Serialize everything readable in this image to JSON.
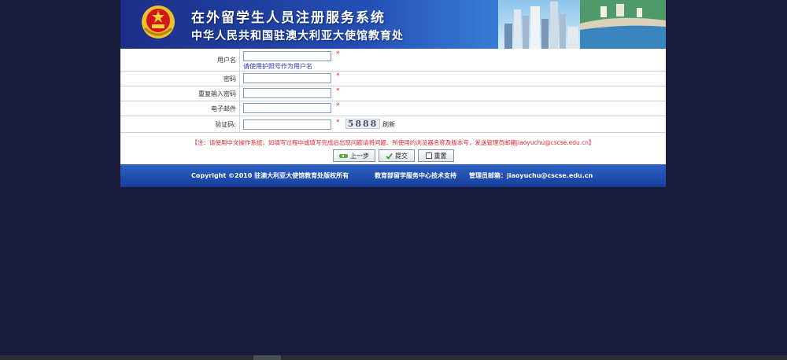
{
  "banner": {
    "title": "在外留学生人员注册服务系统",
    "subtitle": "中华人民共和国驻澳大利亚大使馆教育处"
  },
  "form": {
    "username": {
      "label": "用户名",
      "value": "",
      "required": "*",
      "hint": "请使用护照号作为用户名"
    },
    "password": {
      "label": "密码",
      "value": "",
      "required": "*"
    },
    "confirm_password": {
      "label": "重复输入密码",
      "value": "",
      "required": "*"
    },
    "email": {
      "label": "电子邮件",
      "value": "",
      "required": "*"
    },
    "captcha": {
      "label": "验证码:",
      "value": "",
      "required": "*",
      "code": "5888",
      "refresh_label": "刷新"
    }
  },
  "note": "【注：请使用中文操作系统，如填写过程中或填写完成后出现问题请将问题、所使用的浏览器名称及版本号，发送管理员邮箱jiaoyuchu@cscse.edu.cn】",
  "buttons": {
    "prev": "上一步",
    "submit": "提交",
    "reset": "重置"
  },
  "footer": {
    "copyright": "Copyright ©2010 驻澳大利亚大使馆教育处版权所有",
    "support": "教育部留学服务中心技术支持",
    "admin": "管理员邮箱：jiaoyuchu@cscse.edu.cn"
  },
  "colors": {
    "page_background": "#1a1b3b",
    "banner_blue": "#244fb5",
    "footer_blue": "#1e4fb0",
    "required_red": "#e3262d",
    "hint_blue": "#2a35b3"
  },
  "icons": {
    "emblem": "national-emblem-icon",
    "prev": "back-arrow-icon",
    "submit": "check-icon",
    "reset": "reset-box-icon"
  }
}
